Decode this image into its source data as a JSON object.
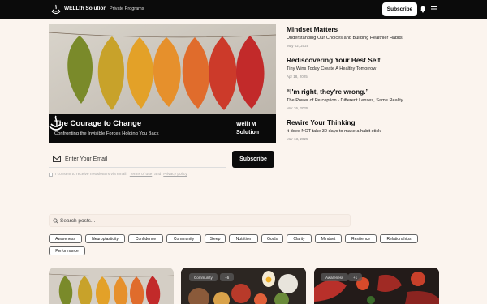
{
  "header": {
    "brand": "WELLth Solution",
    "nav_link": "Private Programs",
    "subscribe_label": "Subscribe",
    "bar_color": "#0b0b0b"
  },
  "hero": {
    "title": "The Courage to Change",
    "subtitle": "Confronting the Invisible Forces Holding You Back",
    "logo_line1": "WellTM",
    "logo_line2": "Solution"
  },
  "newsletter": {
    "email_placeholder": "Enter Your Email",
    "subscribe_label": "Subscribe",
    "consent_text": "I consent to receive newsletters via email.",
    "terms_label": "Terms of use",
    "and_text": "and",
    "privacy_label": "Privacy policy"
  },
  "articles": [
    {
      "title": "Mindset Matters",
      "subtitle": "Understanding Our Choices and Building Healthier Habits",
      "date": "May 02, 2025"
    },
    {
      "title": "Rediscovering Your Best Self",
      "subtitle": "Tiny Wins Today Create A Healthy Tomorrow",
      "date": "Apr 18, 2025"
    },
    {
      "title": "“I'm right, they're wrong.”",
      "subtitle": "The Power of Perception - Different Lenses, Same Reality",
      "date": "Mar 26, 2025"
    },
    {
      "title": "Rewire Your Thinking",
      "subtitle": "It does NOT take 30 days to make a habit stick",
      "date": "Mar 13, 2025"
    }
  ],
  "search": {
    "placeholder": "Search posts..."
  },
  "tags": [
    "Awareness",
    "Neuroplasticity",
    "Confidence",
    "Community",
    "Sleep",
    "Nutrition",
    "Goals",
    "Clarity",
    "Mindset",
    "Resilience",
    "Relationships",
    "Performance"
  ],
  "cards": [
    {
      "chips": []
    },
    {
      "chips": [
        "Community",
        "+6"
      ]
    },
    {
      "chips": [
        "Awareness",
        "+1"
      ]
    }
  ]
}
